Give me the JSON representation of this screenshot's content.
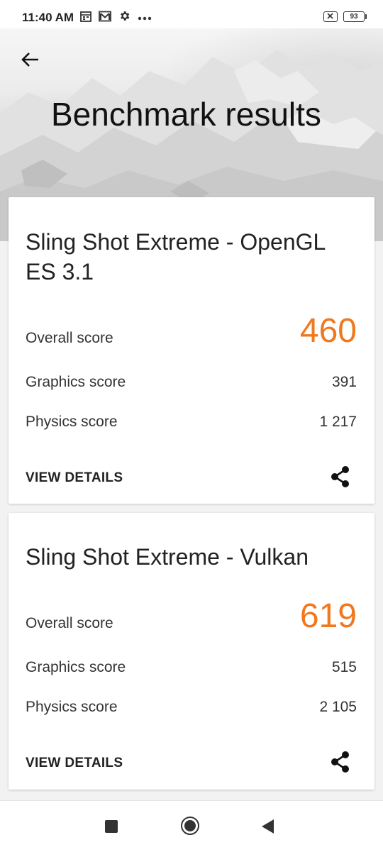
{
  "status_bar": {
    "time": "11:40 AM",
    "icons": [
      "calendar-icon",
      "gmail-icon",
      "settings-icon",
      "more-dots-icon"
    ],
    "battery_level": "93"
  },
  "header": {
    "title": "Benchmark results",
    "back_icon": "arrow-left-icon"
  },
  "colors": {
    "accent": "#f0781e",
    "card_bg": "#ffffff",
    "page_bg": "#f2f2f2"
  },
  "results": [
    {
      "title": "Sling Shot Extreme - OpenGL ES 3.1",
      "overall_label": "Overall score",
      "overall_value": "460",
      "graphics_label": "Graphics score",
      "graphics_value": "391",
      "physics_label": "Physics score",
      "physics_value": "1 217",
      "details_label": "VIEW DETAILS",
      "share_icon": "share-icon"
    },
    {
      "title": "Sling Shot Extreme - Vulkan",
      "overall_label": "Overall score",
      "overall_value": "619",
      "graphics_label": "Graphics score",
      "graphics_value": "515",
      "physics_label": "Physics score",
      "physics_value": "2 105",
      "details_label": "VIEW DETAILS",
      "share_icon": "share-icon"
    }
  ],
  "nav_bar": {
    "buttons": [
      "recents-icon",
      "home-icon",
      "back-icon"
    ]
  }
}
